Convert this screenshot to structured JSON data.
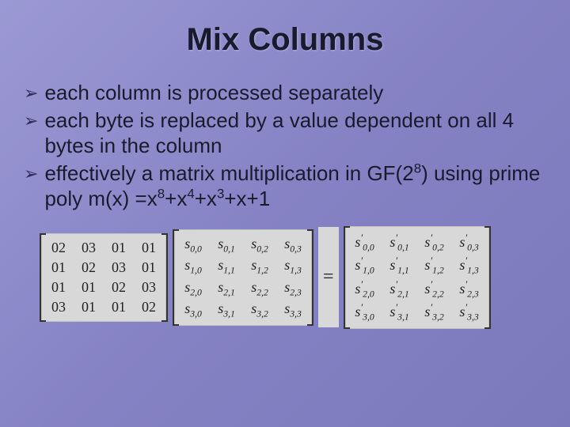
{
  "title": "Mix Columns",
  "bullets": [
    {
      "text": "each column is processed separately"
    },
    {
      "text": "each byte is replaced by a value dependent on all 4 bytes in the column"
    },
    {
      "text_html": "effectively a matrix multiplication in GF(2<sup>8</sup>) using prime poly m(x) =x<sup>8</sup>+x<sup>4</sup>+x<sup>3</sup>+x+1"
    }
  ],
  "equation": {
    "M": [
      [
        "02",
        "03",
        "01",
        "01"
      ],
      [
        "01",
        "02",
        "03",
        "01"
      ],
      [
        "01",
        "01",
        "02",
        "03"
      ],
      [
        "03",
        "01",
        "01",
        "02"
      ]
    ],
    "S_subs": [
      [
        "0,0",
        "0,1",
        "0,2",
        "0,3"
      ],
      [
        "1,0",
        "1,1",
        "1,2",
        "1,3"
      ],
      [
        "2,0",
        "2,1",
        "2,2",
        "2,3"
      ],
      [
        "3,0",
        "3,1",
        "3,2",
        "3,3"
      ]
    ],
    "Sp_subs": [
      [
        "0,0",
        "0,1",
        "0,2",
        "0,3"
      ],
      [
        "1,0",
        "1,1",
        "1,2",
        "1,3"
      ],
      [
        "2,0",
        "2,1",
        "2,2",
        "2,3"
      ],
      [
        "3,0",
        "3,1",
        "3,2",
        "3,3"
      ]
    ],
    "equals": "="
  }
}
